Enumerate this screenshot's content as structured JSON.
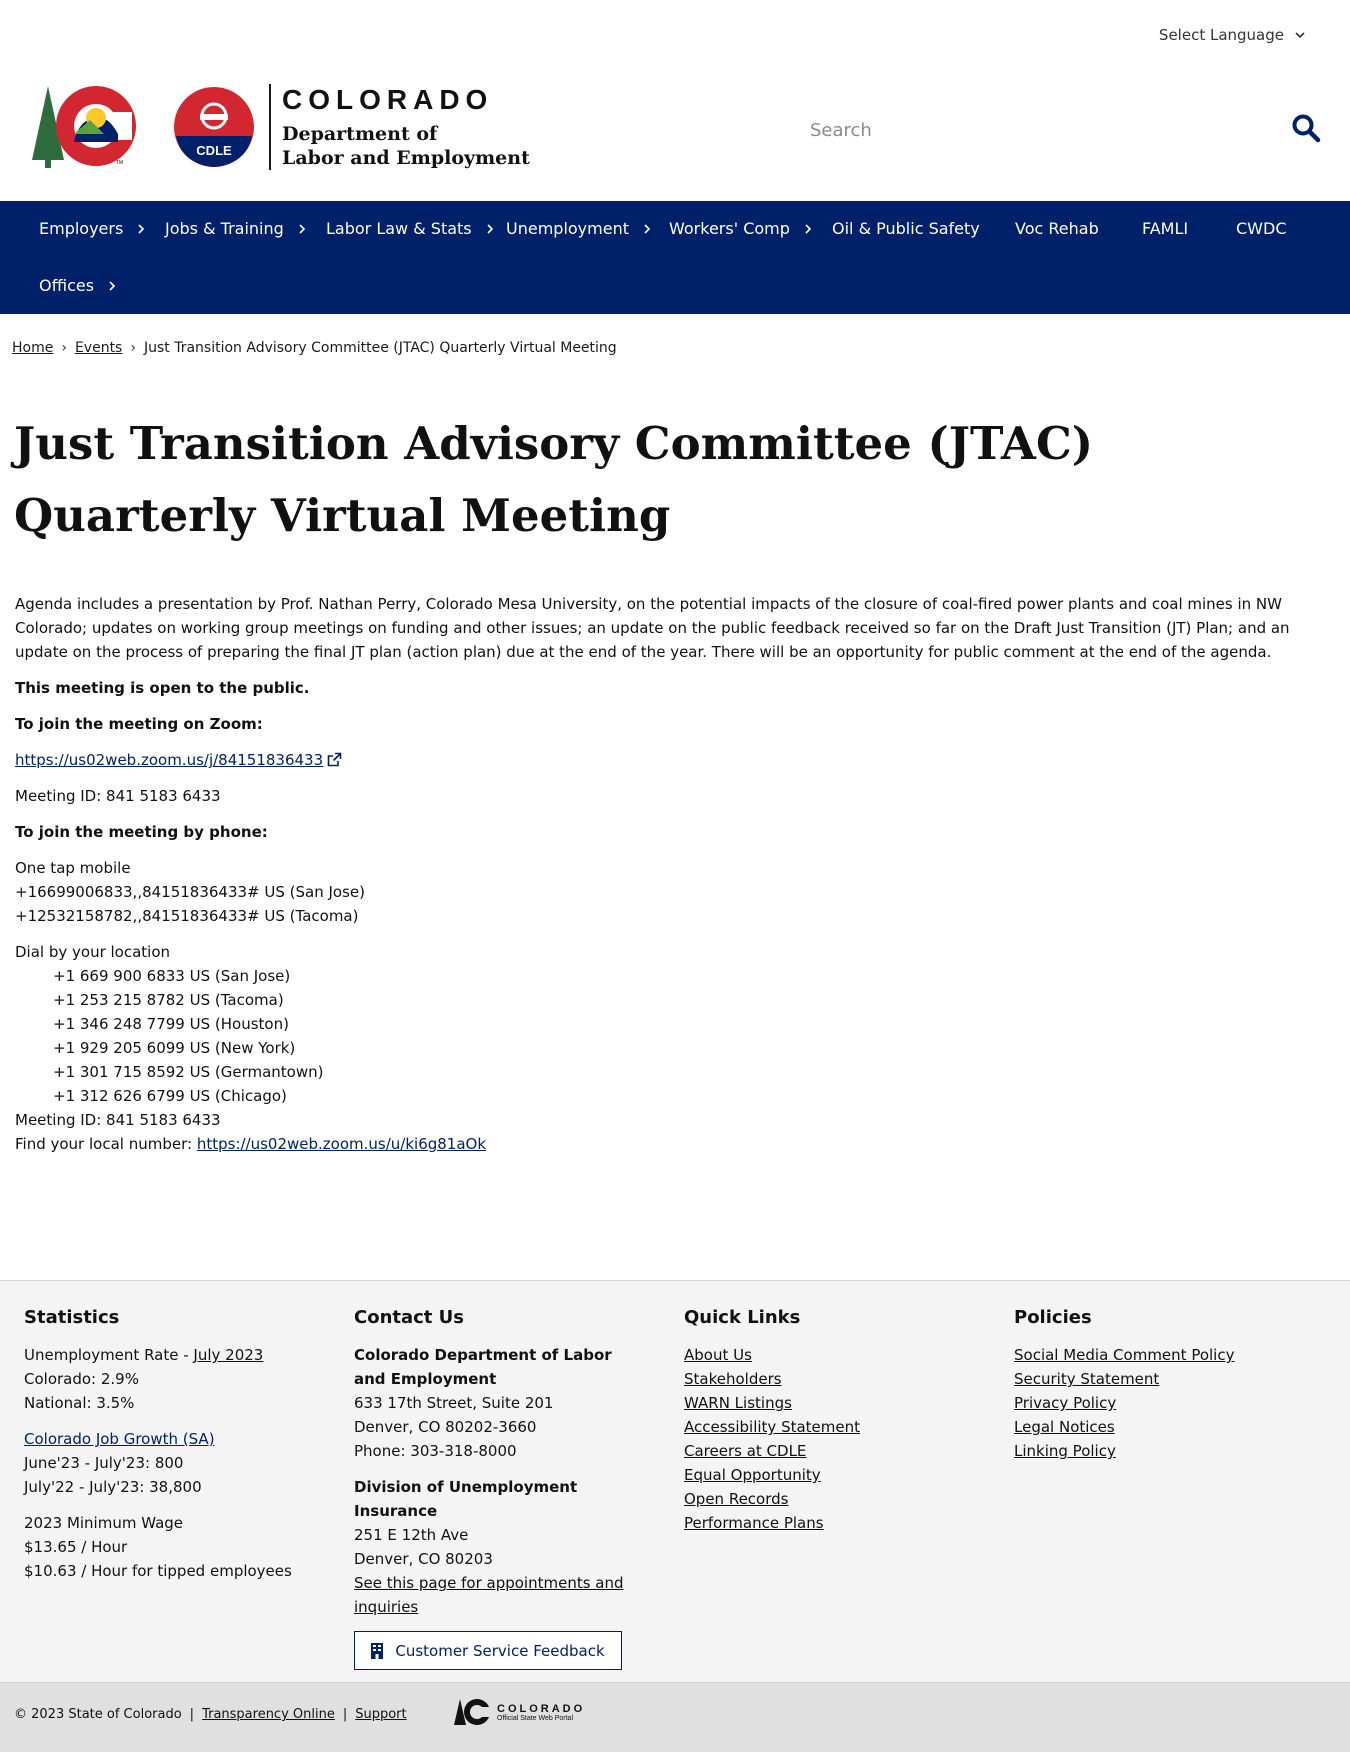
{
  "header": {
    "language_label": "Select Language",
    "logo": {
      "state": "COLORADO",
      "dept_line1": "Department of",
      "dept_line2": "Labor and Employment",
      "badge": "CDLE"
    },
    "search_placeholder": "Search"
  },
  "nav": {
    "items": [
      {
        "label": "Employers",
        "has_submenu": true
      },
      {
        "label": "Jobs & Training",
        "has_submenu": true
      },
      {
        "label": "Labor Law & Stats",
        "has_submenu": true
      },
      {
        "label": "Unemployment",
        "has_submenu": true
      },
      {
        "label": "Workers' Comp",
        "has_submenu": true
      },
      {
        "label": "Oil & Public Safety",
        "has_submenu": false
      },
      {
        "label": "Voc Rehab",
        "has_submenu": false
      },
      {
        "label": "FAMLI",
        "has_submenu": false
      },
      {
        "label": "CWDC",
        "has_submenu": false
      },
      {
        "label": "Offices",
        "has_submenu": true
      }
    ]
  },
  "breadcrumb": {
    "home": "Home",
    "events": "Events",
    "current": "Just Transition Advisory Committee (JTAC) Quarterly Virtual Meeting",
    "separator": "›"
  },
  "page": {
    "title": "Just Transition Advisory Committee (JTAC) Quarterly Virtual Meeting",
    "agenda": "Agenda includes a presentation by Prof. Nathan Perry, Colorado Mesa University, on the potential impacts of the closure of coal-fired power plants and coal mines in NW Colorado; updates on working group meetings on funding and other issues; an update on the public feedback received so far on the Draft Just Transition (JT) Plan; and an update on the process of preparing the final JT plan (action plan) due at the end of the year. There will be an opportunity for public comment at the end of the agenda.",
    "open_public": "This meeting is open to the public.",
    "zoom_heading": "To join the meeting on Zoom:",
    "zoom_url": "https://us02web.zoom.us/j/84151836433",
    "meeting_id_1": "Meeting ID: 841 5183 6433",
    "phone_heading": "To join the meeting by phone:",
    "one_tap_label": "One tap mobile",
    "one_tap": [
      "+16699006833,,84151836433# US (San Jose)",
      "+12532158782,,84151836433# US (Tacoma)"
    ],
    "dial_label": "Dial by your location",
    "dial_numbers": [
      "+1 669 900 6833 US (San Jose)",
      "+1 253 215 8782 US (Tacoma)",
      "+1 346 248 7799 US (Houston)",
      "+1 929 205 6099 US (New York)",
      "+1 301 715 8592 US (Germantown)",
      "+1 312 626 6799 US (Chicago)"
    ],
    "meeting_id_2": "Meeting ID: 841 5183 6433",
    "local_number_label": "Find your local number:",
    "local_number_url": "https://us02web.zoom.us/u/ki6g81aOk"
  },
  "footer": {
    "statistics": {
      "heading": "Statistics",
      "unemp_label": "Unemployment Rate - ",
      "unemp_link": "July 2023",
      "colorado": "Colorado: 2.9%",
      "national": "National: 3.5%",
      "job_growth_link": "Colorado Job Growth (SA)",
      "growth_1": "June'23 - July'23: 800",
      "growth_2": "July'22 - July'23: 38,800",
      "wage_label": "2023 Minimum Wage",
      "wage_1": "$13.65 / Hour",
      "wage_2": "$10.63 / Hour for tipped employees"
    },
    "contact": {
      "heading": "Contact Us",
      "org": "Colorado Department of Labor and Employment",
      "addr1": "633 17th Street, Suite 201",
      "addr2": "Denver, CO  80202-3660",
      "phone": "Phone: 303-318-8000",
      "div_name": "Division of Unemployment Insurance",
      "div_addr1": "251 E 12th Ave",
      "div_addr2": "Denver, CO  80203",
      "div_link": "See this page for appointments and inquiries",
      "feedback_button": "Customer Service Feedback"
    },
    "quick_links": {
      "heading": "Quick Links",
      "items": [
        "About Us",
        "Stakeholders",
        "WARN Listings",
        "Accessibility Statement",
        "Careers at CDLE",
        "Equal Opportunity",
        "Open Records",
        "Performance Plans"
      ]
    },
    "policies": {
      "heading": "Policies",
      "items": [
        "Social Media Comment Policy",
        "Security Statement",
        "Privacy Policy",
        "Legal Notices",
        "Linking Policy"
      ]
    },
    "bottom": {
      "copyright": "© 2023 State of Colorado",
      "sep": "|",
      "transparency": "Transparency Online",
      "support": "Support",
      "portal_title": "COLORADO",
      "portal_sub": "Official State Web Portal"
    }
  },
  "colors": {
    "nav_bg": "#002169",
    "link_blue": "#002169",
    "logo_red": "#d22630",
    "logo_blue": "#002169",
    "logo_yellow": "#ffc72c",
    "logo_green": "#2f6b3c",
    "footer_bg": "#f4f4f4"
  },
  "icons": [
    "chevron-down-icon",
    "search-icon",
    "chevron-right-icon",
    "external-link-icon",
    "building-icon",
    "colorado-c-logo",
    "cdle-badge-logo"
  ]
}
